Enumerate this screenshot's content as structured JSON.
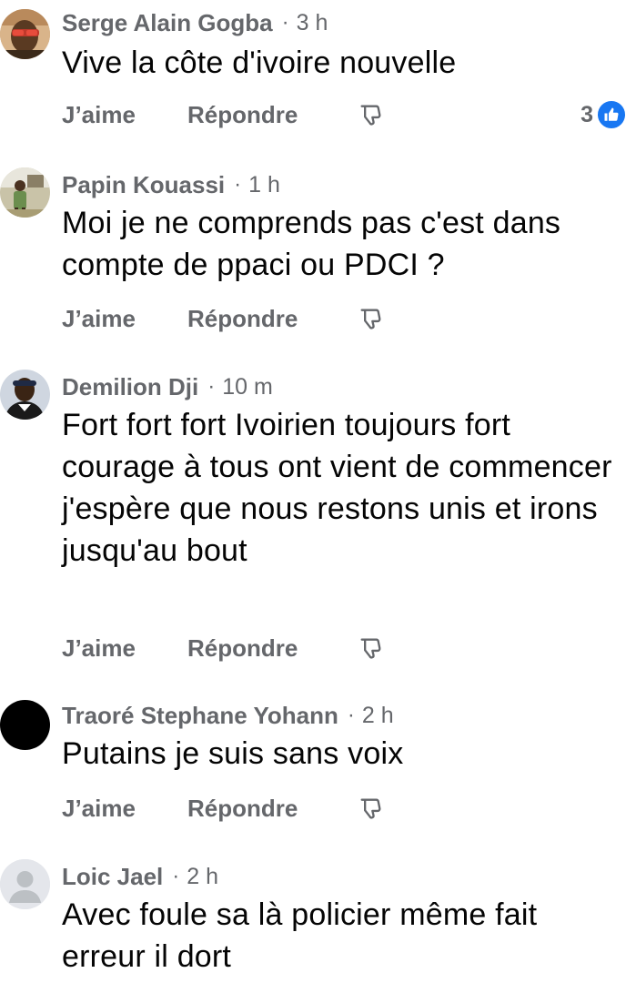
{
  "labels": {
    "like": "J’aime",
    "reply": "Répondre",
    "separator": "·"
  },
  "comments": [
    {
      "author": "Serge Alain Gogba",
      "time": "3 h",
      "text": "Vive la côte d'ivoire nouvelle",
      "reactions": "3",
      "avatar_icon": "profile-photo"
    },
    {
      "author": "Papin Kouassi",
      "time": "1 h",
      "text": "Moi je ne comprends pas c'est dans compte de ppaci ou PDCI ?",
      "avatar_icon": "profile-photo"
    },
    {
      "author": "Demilion Dji",
      "time": "10 m",
      "text": "Fort fort fort Ivoirien toujours fort courage à tous ont vient de commencer j'espère que nous restons unis et irons jusqu'au bout",
      "avatar_icon": "profile-photo"
    },
    {
      "author": "Traoré Stephane Yohann",
      "time": "2 h",
      "text": "Putains je suis sans voix",
      "avatar_icon": "black-profile-photo"
    },
    {
      "author": "Loic Jael",
      "time": "2 h",
      "text": "Avec foule sa là policier même fait erreur il dort",
      "avatar_icon": "default-avatar-icon"
    }
  ],
  "colors": {
    "secondary_text": "#65676b",
    "primary_text": "#050505",
    "like_blue": "#1877f2"
  }
}
